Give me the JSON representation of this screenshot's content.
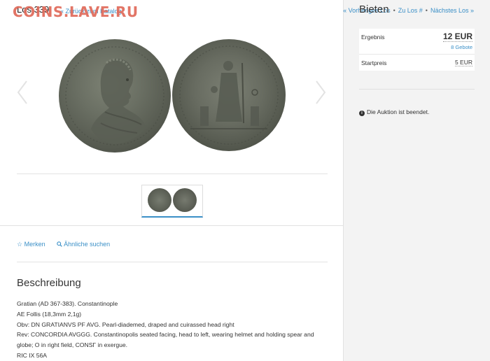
{
  "lot": {
    "title": "Los 339"
  },
  "watermark": "COINS.LAVE.RU",
  "nav": {
    "back": "« Zurück zum Katalog",
    "previous": "« Vorheriges Los",
    "goto": "Zu Los #",
    "next": "Nächstes Los »",
    "sep": "•"
  },
  "actions": {
    "watch": "☆ Merken",
    "search_icon": "magnifier-icon",
    "search_similar": "Ähnliche suchen"
  },
  "description": {
    "heading": "Beschreibung",
    "lines": [
      "Gratian (AD 367-383). Constantinople",
      "AE Follis (18,3mm 2,1g)",
      "Obv: DN GRATIANVS PF AVG. Pearl-diademed, draped and cuirassed head right",
      "Rev: CONCORDIA AVGGG. Constantinopolis seated facing, head to left, wearing helmet and holding spear and",
      "globe; O in right field, CONSΓ in exergue.",
      "RIC IX 56A"
    ]
  },
  "bidding": {
    "title": "Bieten",
    "result_label": "Ergebnis",
    "result_value": "12 EUR",
    "bids_count": "8 Gebote",
    "start_label": "Startpreis",
    "start_value": "5 EUR",
    "ended_text": "Die Auktion ist beendet."
  },
  "colors": {
    "link": "#3a8fc7",
    "watermark": "#e06a5a"
  }
}
